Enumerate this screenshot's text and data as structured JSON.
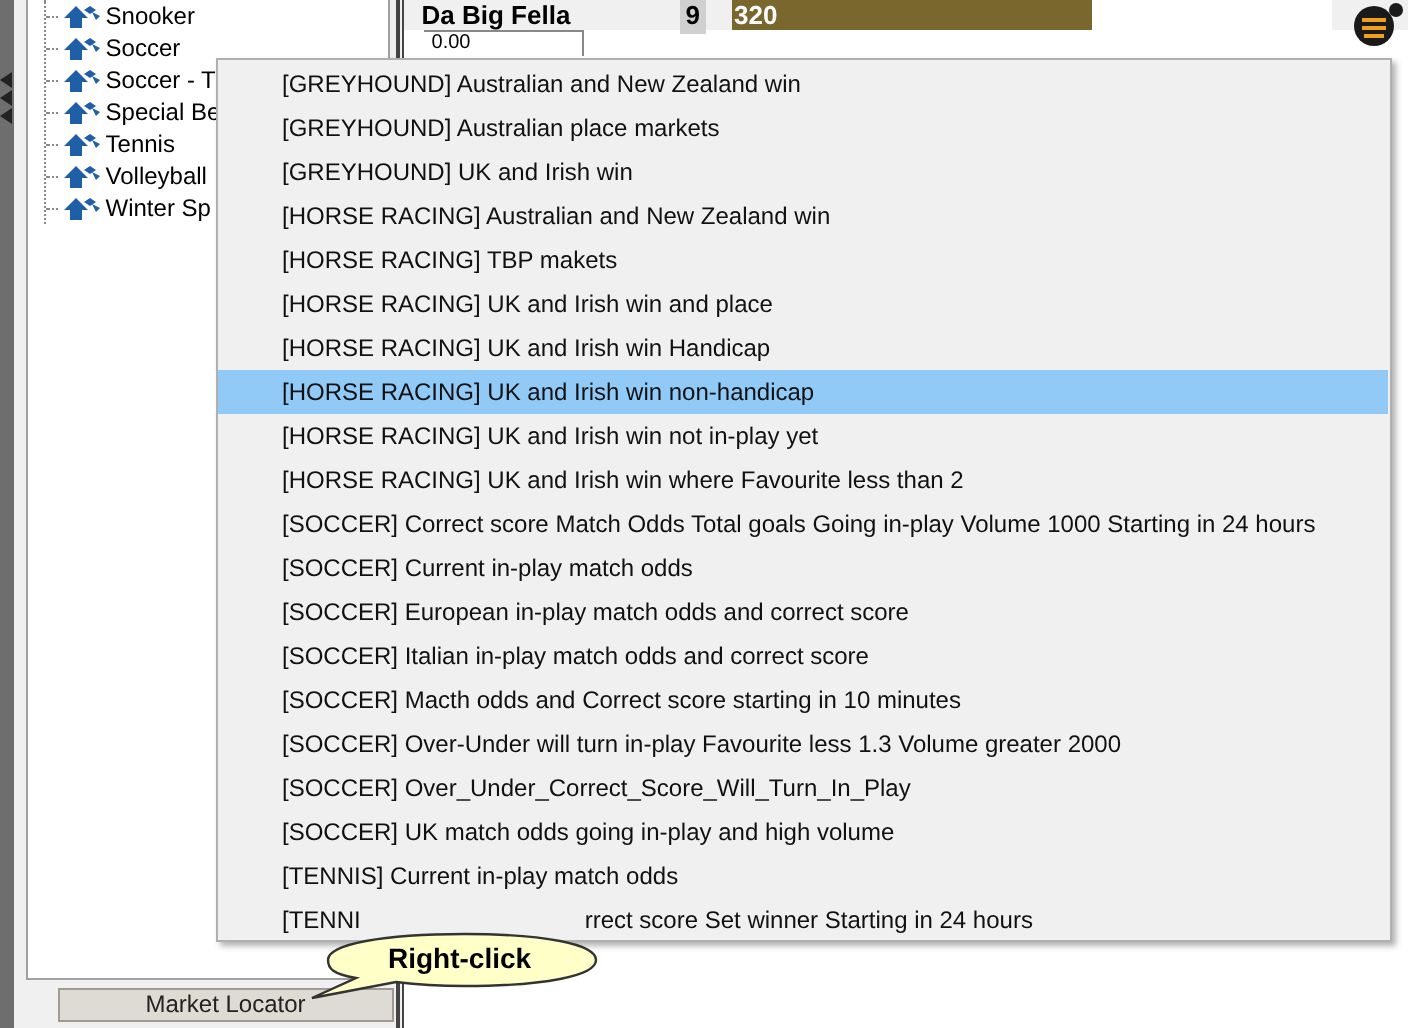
{
  "sidebar": {
    "tree_items": [
      {
        "label": "Snooker"
      },
      {
        "label": "Soccer"
      },
      {
        "label": "Soccer - T"
      },
      {
        "label": "Special Be"
      },
      {
        "label": "Tennis"
      },
      {
        "label": "Volleyball"
      },
      {
        "label": "Winter Sp"
      }
    ],
    "button": "Market Locator"
  },
  "runner": {
    "name": "Da Big Fella",
    "number": "9",
    "price": "0.00",
    "bar_value": "320",
    "level": 0.6
  },
  "context_menu": {
    "items": [
      {
        "label": "[GREYHOUND] Australian and New Zealand win",
        "selected": false
      },
      {
        "label": "[GREYHOUND] Australian place markets",
        "selected": false
      },
      {
        "label": "[GREYHOUND] UK and Irish win",
        "selected": false
      },
      {
        "label": "[HORSE RACING] Australian and New Zealand win",
        "selected": false
      },
      {
        "label": "[HORSE RACING] TBP makets",
        "selected": false
      },
      {
        "label": "[HORSE RACING] UK and Irish win and place",
        "selected": false
      },
      {
        "label": "[HORSE RACING] UK and Irish win Handicap",
        "selected": false
      },
      {
        "label": "[HORSE RACING] UK and Irish win non-handicap",
        "selected": true
      },
      {
        "label": "[HORSE RACING] UK and Irish win not in-play yet",
        "selected": false
      },
      {
        "label": "[HORSE RACING] UK and Irish win where Favourite less than 2",
        "selected": false
      },
      {
        "label": "[SOCCER] Correct score Match Odds Total goals Going in-play Volume 1000 Starting in 24 hours",
        "selected": false
      },
      {
        "label": "[SOCCER] Current in-play match odds",
        "selected": false
      },
      {
        "label": "[SOCCER] European in-play match odds and correct score",
        "selected": false
      },
      {
        "label": "[SOCCER] Italian in-play match odds and correct score",
        "selected": false
      },
      {
        "label": "[SOCCER] Macth odds and Correct score starting in 10 minutes",
        "selected": false
      },
      {
        "label": "[SOCCER] Over-Under will turn in-play Favourite less 1.3 Volume greater 2000",
        "selected": false
      },
      {
        "label": "[SOCCER] Over_Under_Correct_Score_Will_Turn_In_Play",
        "selected": false
      },
      {
        "label": "[SOCCER] UK match odds going in-play and high volume",
        "selected": false
      },
      {
        "label": "[TENNIS] Current in-play match odds",
        "selected": false
      },
      {
        "label": "[TENNI",
        "label_end": "rrect score Set winner Starting in 24 hours",
        "selected": false
      }
    ]
  },
  "callout": {
    "text": "Right-click"
  }
}
